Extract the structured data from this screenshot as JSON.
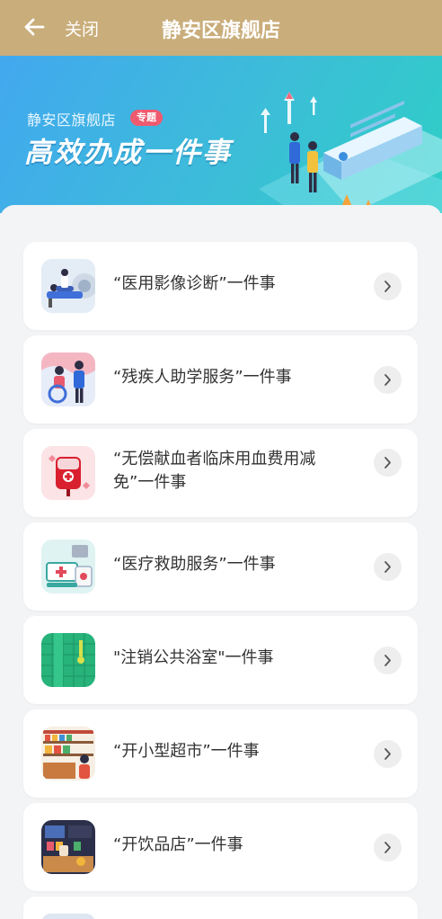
{
  "header": {
    "close_label": "关闭",
    "title": "静安区旗舰店"
  },
  "banner": {
    "subtitle": "静安区旗舰店",
    "tag": "专题",
    "headline": "高效办成一件事"
  },
  "items": [
    {
      "label": "“医用影像诊断”一件事",
      "icon": "medical-imaging-icon"
    },
    {
      "label": "“残疾人助学服务”一件事",
      "icon": "disability-education-icon"
    },
    {
      "label": "“无偿献血者临床用血费用减免”一件事",
      "icon": "blood-donation-icon"
    },
    {
      "label": "“医疗救助服务”一件事",
      "icon": "medical-aid-icon"
    },
    {
      "label": "\"注销公共浴室\"一件事",
      "icon": "public-bathhouse-icon"
    },
    {
      "label": "“开小型超市”一件事",
      "icon": "supermarket-icon"
    },
    {
      "label": "“开饮品店”一件事",
      "icon": "drink-shop-icon"
    }
  ],
  "colors": {
    "header_bg": "#c9ad7a",
    "banner_start": "#42a8ef",
    "banner_end": "#2ecfc6",
    "tag_bg": "#ef5a6f"
  }
}
